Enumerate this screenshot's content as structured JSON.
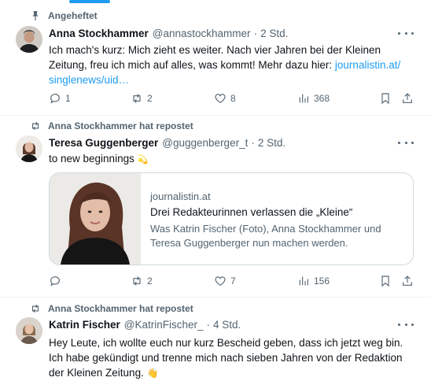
{
  "tweets": [
    {
      "social": "Angeheftet",
      "social_icon": "pin-icon",
      "name": "Anna Stockhammer",
      "handle": "@annastockhammer",
      "time": "2 Std.",
      "text": "Ich mach's kurz: Mich zieht es weiter. Nach vier Jahren bei der Kleinen Zeitung, freu ich mich auf alles, was kommt! Mehr dazu hier:",
      "link": "journalistin.at/singlenews/uid…",
      "link_line1": "journalistin.at/",
      "link_line2": "singlenews/uid…",
      "replies": "1",
      "reposts": "2",
      "likes": "8",
      "views": "368"
    },
    {
      "social": "Anna Stockhammer hat repostet",
      "social_icon": "repost-icon",
      "name": "Teresa Guggenberger",
      "handle": "@guggenberger_t",
      "time": "2 Std.",
      "text": "to new beginnings",
      "emoji": "💫",
      "card": {
        "domain": "journalistin.at",
        "title": "Drei Redakteurinnen verlassen die „Kleine“",
        "description": "Was Katrin Fischer (Foto), Anna Stockhammer und Teresa Guggenberger nun machen werden."
      },
      "replies": "",
      "reposts": "2",
      "likes": "7",
      "views": "156"
    },
    {
      "social": "Anna Stockhammer hat repostet",
      "social_icon": "repost-icon",
      "name": "Katrin Fischer",
      "handle": "@KatrinFischer_",
      "time": "4 Std.",
      "text_line1": "Hey Leute,  ich wollte euch nur kurz Bescheid geben, dass ich jetzt weg bin.",
      "text_line2": "Ich habe gekündigt und trenne mich nach sieben Jahren von der Redaktion",
      "text_line3": "der Kleinen Zeitung.",
      "emoji": "👋"
    }
  ],
  "colors": {
    "accent": "#1d9bf0",
    "muted": "#536471",
    "text": "#0f1419",
    "border": "#eff3f4"
  }
}
